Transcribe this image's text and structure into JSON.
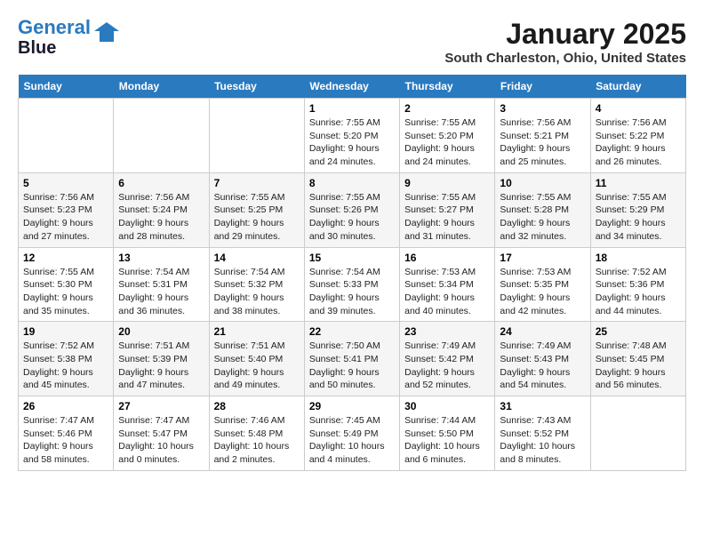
{
  "logo": {
    "line1": "General",
    "line2": "Blue"
  },
  "title": "January 2025",
  "subtitle": "South Charleston, Ohio, United States",
  "headers": [
    "Sunday",
    "Monday",
    "Tuesday",
    "Wednesday",
    "Thursday",
    "Friday",
    "Saturday"
  ],
  "weeks": [
    [
      {
        "day": "",
        "info": ""
      },
      {
        "day": "",
        "info": ""
      },
      {
        "day": "",
        "info": ""
      },
      {
        "day": "1",
        "info": "Sunrise: 7:55 AM\nSunset: 5:20 PM\nDaylight: 9 hours\nand 24 minutes."
      },
      {
        "day": "2",
        "info": "Sunrise: 7:55 AM\nSunset: 5:20 PM\nDaylight: 9 hours\nand 24 minutes."
      },
      {
        "day": "3",
        "info": "Sunrise: 7:56 AM\nSunset: 5:21 PM\nDaylight: 9 hours\nand 25 minutes."
      },
      {
        "day": "4",
        "info": "Sunrise: 7:56 AM\nSunset: 5:22 PM\nDaylight: 9 hours\nand 26 minutes."
      }
    ],
    [
      {
        "day": "5",
        "info": "Sunrise: 7:56 AM\nSunset: 5:23 PM\nDaylight: 9 hours\nand 27 minutes."
      },
      {
        "day": "6",
        "info": "Sunrise: 7:56 AM\nSunset: 5:24 PM\nDaylight: 9 hours\nand 28 minutes."
      },
      {
        "day": "7",
        "info": "Sunrise: 7:55 AM\nSunset: 5:25 PM\nDaylight: 9 hours\nand 29 minutes."
      },
      {
        "day": "8",
        "info": "Sunrise: 7:55 AM\nSunset: 5:26 PM\nDaylight: 9 hours\nand 30 minutes."
      },
      {
        "day": "9",
        "info": "Sunrise: 7:55 AM\nSunset: 5:27 PM\nDaylight: 9 hours\nand 31 minutes."
      },
      {
        "day": "10",
        "info": "Sunrise: 7:55 AM\nSunset: 5:28 PM\nDaylight: 9 hours\nand 32 minutes."
      },
      {
        "day": "11",
        "info": "Sunrise: 7:55 AM\nSunset: 5:29 PM\nDaylight: 9 hours\nand 34 minutes."
      }
    ],
    [
      {
        "day": "12",
        "info": "Sunrise: 7:55 AM\nSunset: 5:30 PM\nDaylight: 9 hours\nand 35 minutes."
      },
      {
        "day": "13",
        "info": "Sunrise: 7:54 AM\nSunset: 5:31 PM\nDaylight: 9 hours\nand 36 minutes."
      },
      {
        "day": "14",
        "info": "Sunrise: 7:54 AM\nSunset: 5:32 PM\nDaylight: 9 hours\nand 38 minutes."
      },
      {
        "day": "15",
        "info": "Sunrise: 7:54 AM\nSunset: 5:33 PM\nDaylight: 9 hours\nand 39 minutes."
      },
      {
        "day": "16",
        "info": "Sunrise: 7:53 AM\nSunset: 5:34 PM\nDaylight: 9 hours\nand 40 minutes."
      },
      {
        "day": "17",
        "info": "Sunrise: 7:53 AM\nSunset: 5:35 PM\nDaylight: 9 hours\nand 42 minutes."
      },
      {
        "day": "18",
        "info": "Sunrise: 7:52 AM\nSunset: 5:36 PM\nDaylight: 9 hours\nand 44 minutes."
      }
    ],
    [
      {
        "day": "19",
        "info": "Sunrise: 7:52 AM\nSunset: 5:38 PM\nDaylight: 9 hours\nand 45 minutes."
      },
      {
        "day": "20",
        "info": "Sunrise: 7:51 AM\nSunset: 5:39 PM\nDaylight: 9 hours\nand 47 minutes."
      },
      {
        "day": "21",
        "info": "Sunrise: 7:51 AM\nSunset: 5:40 PM\nDaylight: 9 hours\nand 49 minutes."
      },
      {
        "day": "22",
        "info": "Sunrise: 7:50 AM\nSunset: 5:41 PM\nDaylight: 9 hours\nand 50 minutes."
      },
      {
        "day": "23",
        "info": "Sunrise: 7:49 AM\nSunset: 5:42 PM\nDaylight: 9 hours\nand 52 minutes."
      },
      {
        "day": "24",
        "info": "Sunrise: 7:49 AM\nSunset: 5:43 PM\nDaylight: 9 hours\nand 54 minutes."
      },
      {
        "day": "25",
        "info": "Sunrise: 7:48 AM\nSunset: 5:45 PM\nDaylight: 9 hours\nand 56 minutes."
      }
    ],
    [
      {
        "day": "26",
        "info": "Sunrise: 7:47 AM\nSunset: 5:46 PM\nDaylight: 9 hours\nand 58 minutes."
      },
      {
        "day": "27",
        "info": "Sunrise: 7:47 AM\nSunset: 5:47 PM\nDaylight: 10 hours\nand 0 minutes."
      },
      {
        "day": "28",
        "info": "Sunrise: 7:46 AM\nSunset: 5:48 PM\nDaylight: 10 hours\nand 2 minutes."
      },
      {
        "day": "29",
        "info": "Sunrise: 7:45 AM\nSunset: 5:49 PM\nDaylight: 10 hours\nand 4 minutes."
      },
      {
        "day": "30",
        "info": "Sunrise: 7:44 AM\nSunset: 5:50 PM\nDaylight: 10 hours\nand 6 minutes."
      },
      {
        "day": "31",
        "info": "Sunrise: 7:43 AM\nSunset: 5:52 PM\nDaylight: 10 hours\nand 8 minutes."
      },
      {
        "day": "",
        "info": ""
      }
    ]
  ]
}
